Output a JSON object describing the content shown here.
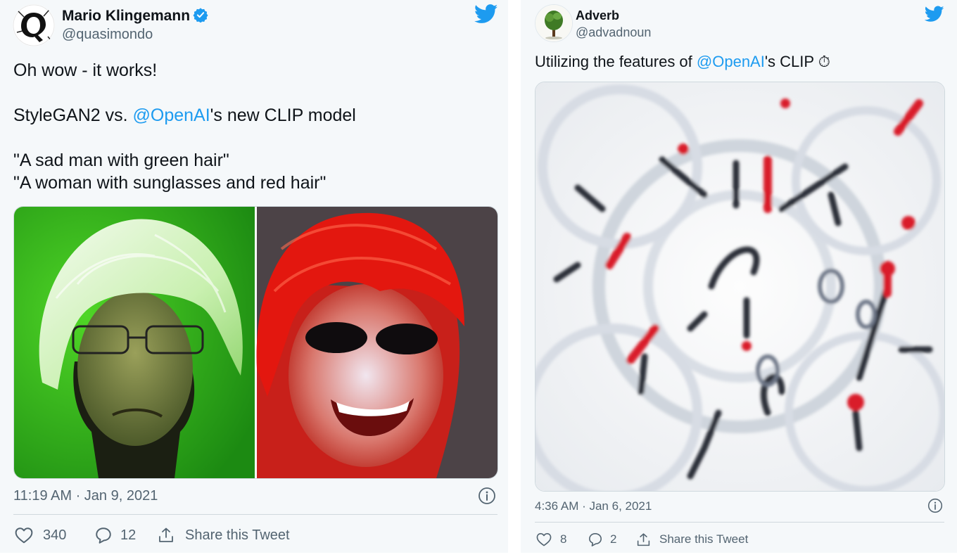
{
  "tweets": [
    {
      "author_name": "Mario Klingemann",
      "author_handle": "@quasimondo",
      "verified": true,
      "text_line1": "Oh wow - it works!",
      "text_line2_mention": "@OpenAI",
      "text_line2_pre": "StyleGAN2 vs. ",
      "text_line2_post": "'s new CLIP model",
      "text_line3": "\"A sad man with green hair\"",
      "text_line4": "\"A woman with sunglasses and red hair\"",
      "timestamp": "11:19 AM · Jan 9, 2021",
      "likes": "340",
      "replies": "12",
      "share_label": "Share this Tweet"
    },
    {
      "author_name": "Adverb",
      "author_handle": "@advadnoun",
      "verified": false,
      "text_pre": "Utilizing the features of ",
      "text_mention": "@OpenAI",
      "text_post": "'s CLIP ⏱",
      "timestamp": "4:36 AM · Jan 6, 2021",
      "likes": "8",
      "replies": "2",
      "share_label": "Share this Tweet"
    }
  ],
  "colors": {
    "accent": "#1d9bf0",
    "secondary_text": "#536471",
    "card_bg": "#f5f8fa"
  },
  "icons": [
    "twitter-bird-icon",
    "verified-badge-icon",
    "heart-icon",
    "reply-icon",
    "share-icon",
    "info-icon"
  ]
}
